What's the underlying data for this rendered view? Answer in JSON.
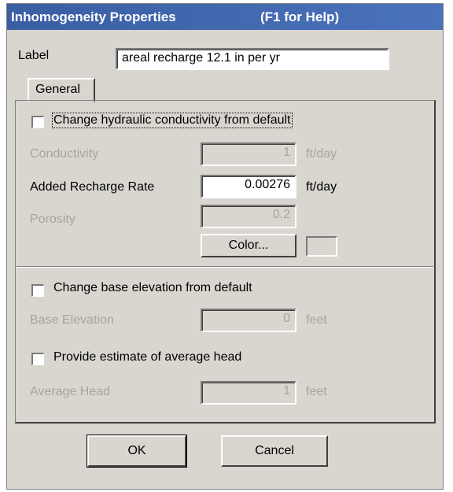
{
  "window": {
    "title": "Inhomogeneity Properties",
    "help_hint": "(F1 for Help)"
  },
  "label_field": {
    "label": "Label",
    "value": "areal recharge 12.1 in per yr"
  },
  "tabs": [
    {
      "label": "General"
    }
  ],
  "conductivity_section": {
    "checkbox_label": "Change hydraulic conductivity from default",
    "checked": false,
    "conductivity": {
      "label": "Conductivity",
      "value": "1",
      "unit": "ft/day"
    },
    "recharge": {
      "label": "Added Recharge Rate",
      "value": "0.00276",
      "unit": "ft/day"
    },
    "porosity": {
      "label": "Porosity",
      "value": "0.2"
    },
    "color_button": "Color..."
  },
  "base_section": {
    "checkbox_label": "Change base elevation from default",
    "checked": false,
    "base_elevation": {
      "label": "Base Elevation",
      "value": "0",
      "unit": "feet"
    },
    "head_checkbox_label": "Provide estimate of average head",
    "head_checked": false,
    "average_head": {
      "label": "Average Head",
      "value": "1",
      "unit": "feet"
    }
  },
  "buttons": {
    "ok": "OK",
    "cancel": "Cancel"
  }
}
